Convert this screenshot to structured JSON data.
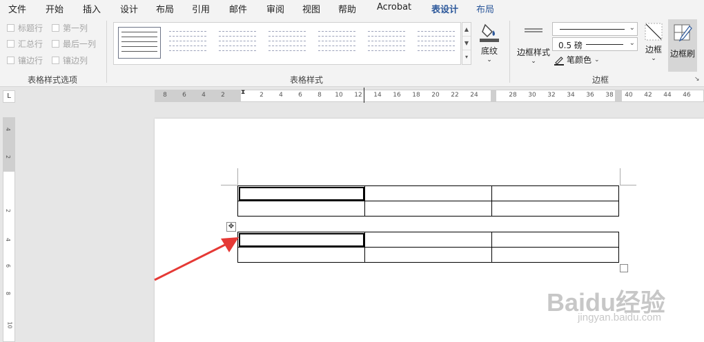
{
  "menu": {
    "items": [
      "文件",
      "开始",
      "插入",
      "设计",
      "布局",
      "引用",
      "邮件",
      "审阅",
      "视图",
      "帮助",
      "Acrobat",
      "表设计",
      "布局"
    ],
    "active_index": 11
  },
  "ribbon": {
    "style_options": {
      "label": "表格样式选项",
      "checks": [
        "标题行",
        "第一列",
        "汇总行",
        "最后一列",
        "镶边行",
        "镶边列"
      ]
    },
    "table_styles": {
      "label": "表格样式"
    },
    "shading": {
      "label": "底纹"
    },
    "borders": {
      "label": "边框",
      "border_styles": "边框样式",
      "weight": "0.5 磅",
      "pen_color": "笔颜色",
      "borders_btn": "边框",
      "painter": "边框刷"
    }
  },
  "ruler": {
    "h_ticks": [
      "8",
      "6",
      "4",
      "2",
      "2",
      "4",
      "6",
      "8",
      "10",
      "12",
      "14",
      "16",
      "18",
      "20",
      "22",
      "24",
      "28",
      "30",
      "32",
      "34",
      "36",
      "38",
      "40",
      "42",
      "44",
      "46"
    ],
    "v_ticks": [
      "4",
      "2",
      "2",
      "4",
      "6",
      "8",
      "10"
    ],
    "corner": "L"
  },
  "watermark": {
    "brand": "Baidu经验",
    "url": "jingyan.baidu.com"
  },
  "colors": {
    "accent": "#2b579a",
    "arrow": "#e53935"
  }
}
